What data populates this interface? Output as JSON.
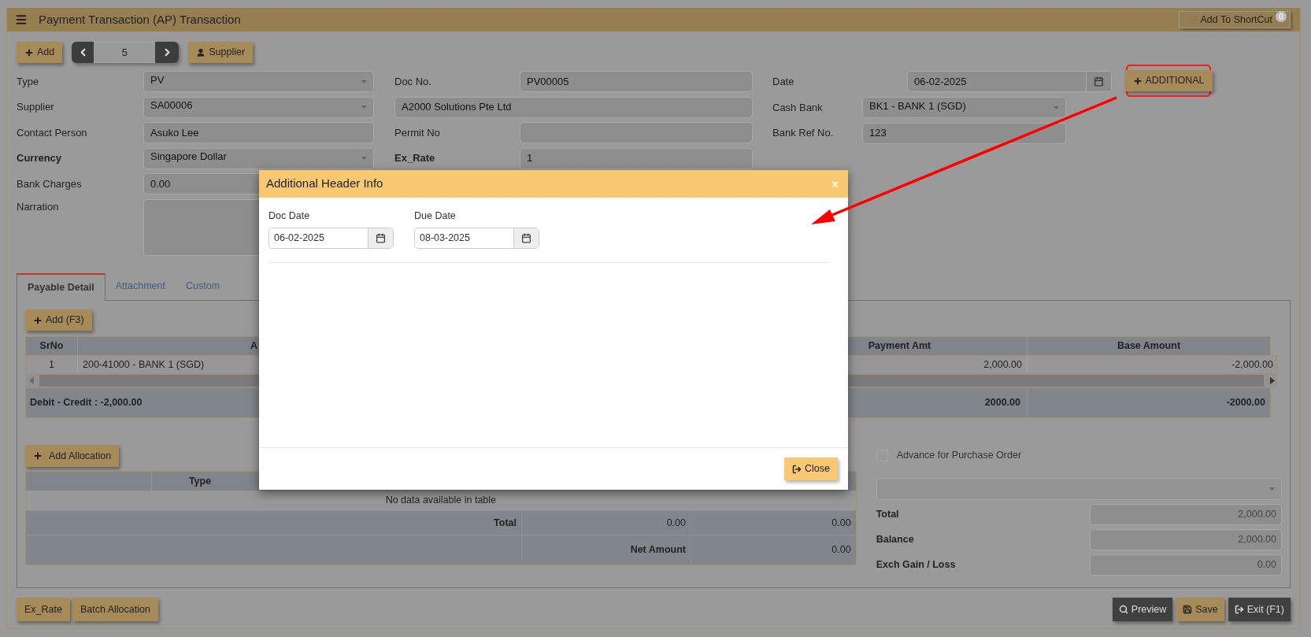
{
  "header": {
    "title": "Payment Transaction (AP) Transaction",
    "shortcut_button": "Add To ShortCut",
    "shortcut_count": "0"
  },
  "toolbar": {
    "add_button": "Add",
    "pager_value": "5",
    "supplier_button": "Supplier"
  },
  "form": {
    "columns": [
      [
        {
          "label": "Type",
          "value": "PV",
          "kind": "select",
          "bold": false
        },
        {
          "label": "Supplier",
          "value": "SA00006",
          "kind": "select",
          "bold": false
        },
        {
          "label": "Contact Person",
          "value": "Asuko Lee",
          "kind": "text",
          "bold": false
        },
        {
          "label": "Currency",
          "value": "Singapore Dollar",
          "kind": "select",
          "bold": true
        },
        {
          "label": "Bank Charges",
          "value": "0.00",
          "kind": "text",
          "bold": false
        },
        {
          "label": "Narration",
          "kind": "textarea",
          "bold": false
        }
      ],
      [
        {
          "label": "Doc No.",
          "value": "PV00005",
          "kind": "text",
          "bold": false
        },
        {
          "value": "A2000 Solutions Pte Ltd",
          "kind": "wide"
        },
        {
          "label": "Permit No",
          "kind": "text",
          "bold": false
        },
        {
          "label": "Ex_Rate",
          "value": "1",
          "kind": "text",
          "bold": true
        }
      ],
      [
        {
          "label": "Date",
          "value": "06-02-2025",
          "kind": "date",
          "bold": false
        },
        {
          "label": "Cash Bank",
          "value": "BK1 - BANK 1 (SGD)",
          "kind": "select",
          "bold": false
        },
        {
          "label": "Bank Ref No.",
          "value": "123",
          "kind": "text",
          "bold": false
        }
      ]
    ],
    "additional_button": "ADDITIONAL"
  },
  "tabs": [
    {
      "label": "Payable Detail",
      "selected": true
    },
    {
      "label": "Attachment",
      "selected": false
    },
    {
      "label": "Custom",
      "selected": false
    }
  ],
  "detail": {
    "add_button": "Add (F3)",
    "columns": [
      "SrNo",
      "A",
      "Payment Amt",
      "Base Amount"
    ],
    "rows": [
      [
        "1",
        "200-41000 - BANK 1 (SGD)",
        "2,000.00",
        "-2,000.00"
      ]
    ],
    "footer": {
      "label": "Debit - Credit : -2,000.00",
      "payment": "2000.00",
      "base": "-2000.00"
    }
  },
  "allocation": {
    "add_button": "Add Allocation",
    "columns": [
      "Type"
    ],
    "empty_text": "No data available in table",
    "totals": [
      {
        "label": "Total",
        "values": [
          "0.00",
          "0.00"
        ]
      },
      {
        "label": "Net Amount",
        "values": [
          "0.00"
        ]
      }
    ]
  },
  "summary": {
    "advance": {
      "label": "Advance for Purchase Order",
      "checked": false
    },
    "rows": [
      {
        "label": "Total",
        "value": "2,000.00"
      },
      {
        "label": "Balance",
        "value": "2,000.00"
      },
      {
        "label": "Exch Gain / Loss",
        "value": "0.00"
      }
    ]
  },
  "bottom_left_buttons": [
    "Ex_Rate",
    "Batch Allocation"
  ],
  "bottom_right_buttons": [
    {
      "label": "Preview",
      "kind": "preview"
    },
    {
      "label": "Save",
      "kind": "save"
    },
    {
      "label": "Exit (F1)",
      "kind": "exit"
    }
  ],
  "modal": {
    "title": "Additional Header Info",
    "close_icon": "×",
    "fields": [
      {
        "label": "Doc Date",
        "value": "06-02-2025"
      },
      {
        "label": "Due Date",
        "value": "08-03-2025"
      }
    ],
    "close_button": "Close"
  }
}
